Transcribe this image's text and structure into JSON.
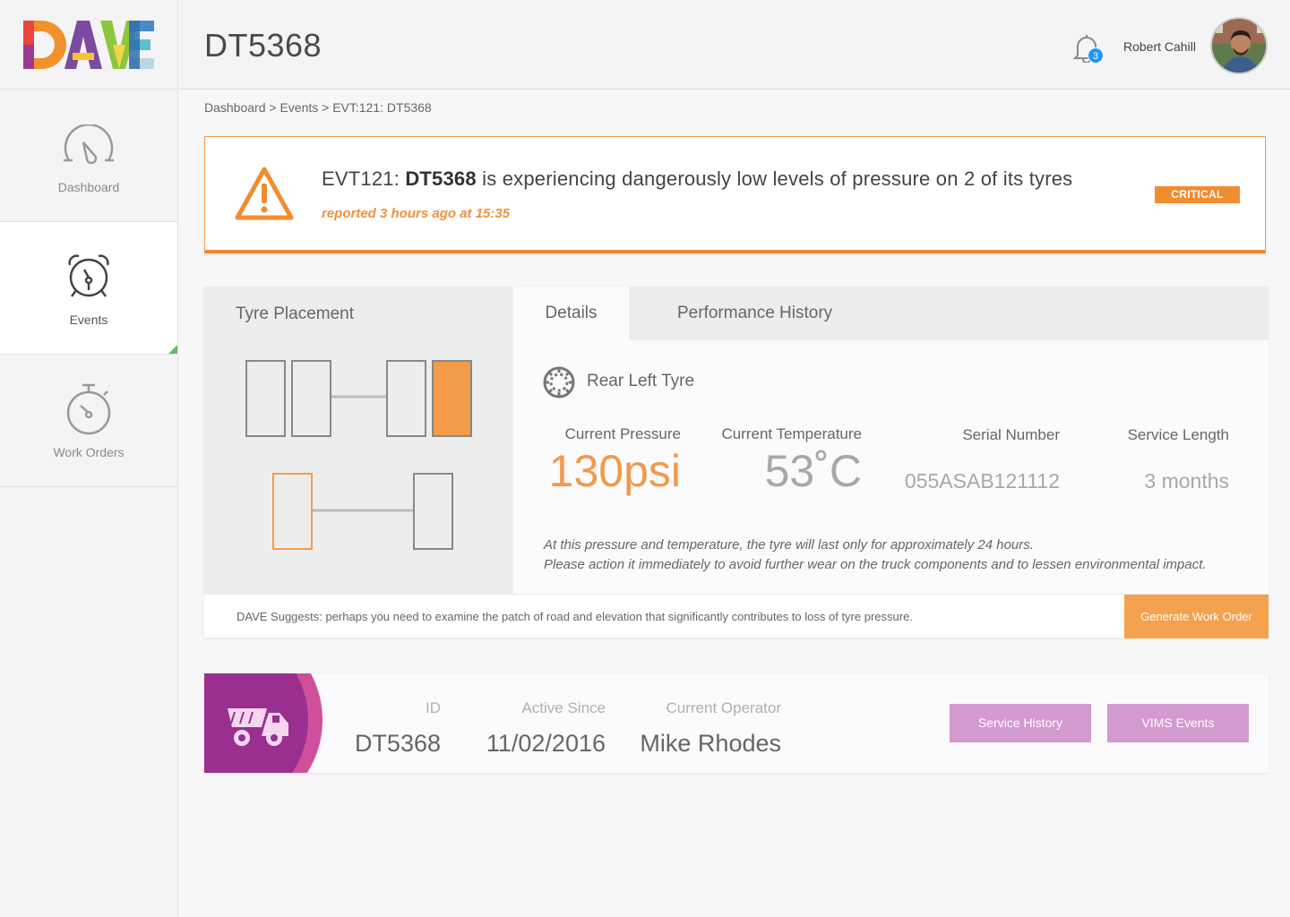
{
  "app": {
    "logo_text": "DAVE"
  },
  "sidebar": {
    "items": [
      {
        "label": "Dashboard",
        "icon": "speedometer-icon",
        "active": false
      },
      {
        "label": "Events",
        "icon": "alarm-clock-icon",
        "active": true
      },
      {
        "label": "Work Orders",
        "icon": "stopwatch-icon",
        "active": false
      }
    ]
  },
  "header": {
    "title": "DT5368",
    "notification_count": "3",
    "user_name": "Robert Cahill"
  },
  "breadcrumb": "Dashboard > Events > EVT:121: DT5368",
  "alert": {
    "event_prefix": "EVT121:",
    "vehicle": "DT5368",
    "message": "is experiencing dangerously low levels of pressure on 2 of its tyres",
    "reported": "reported 3 hours ago at 15:35",
    "severity": "CRITICAL"
  },
  "tyre_placement": {
    "title": "Tyre Placement",
    "highlight_color": "#f39c4a"
  },
  "tabs": [
    {
      "label": "Details",
      "active": true
    },
    {
      "label": "Performance History",
      "active": false
    }
  ],
  "details": {
    "tyre_name": "Rear Left Tyre",
    "metrics": {
      "pressure": {
        "label": "Current Pressure",
        "value": "130psi"
      },
      "temperature": {
        "label": "Current Temperature",
        "value": "53˚C"
      },
      "serial": {
        "label": "Serial Number",
        "value": "055ASAB121112"
      },
      "service": {
        "label": "Service Length",
        "value": "3 months"
      }
    },
    "note_line1": "At this pressure and temperature, the tyre will last only for approximately 24 hours.",
    "note_line2": "Please action it immediately to avoid further wear on the truck components and to lessen environmental impact."
  },
  "suggestion": {
    "text": "DAVE Suggests: perhaps you need to examine the patch of road and elevation that significantly contributes to loss of tyre pressure.",
    "button": "Generate Work Order"
  },
  "vehicle": {
    "icon": "dump-truck-icon",
    "id_label": "ID",
    "id_value": "DT5368",
    "since_label": "Active Since",
    "since_value": "11/02/2016",
    "operator_label": "Current Operator",
    "operator_value": "Mike Rhodes",
    "buttons": [
      "Service History",
      "VIMS Events"
    ]
  },
  "colors": {
    "accent_orange": "#f28c30",
    "purple": "#9b2f8f",
    "pink_button": "#d39ad0",
    "notification_blue": "#2196f3"
  }
}
